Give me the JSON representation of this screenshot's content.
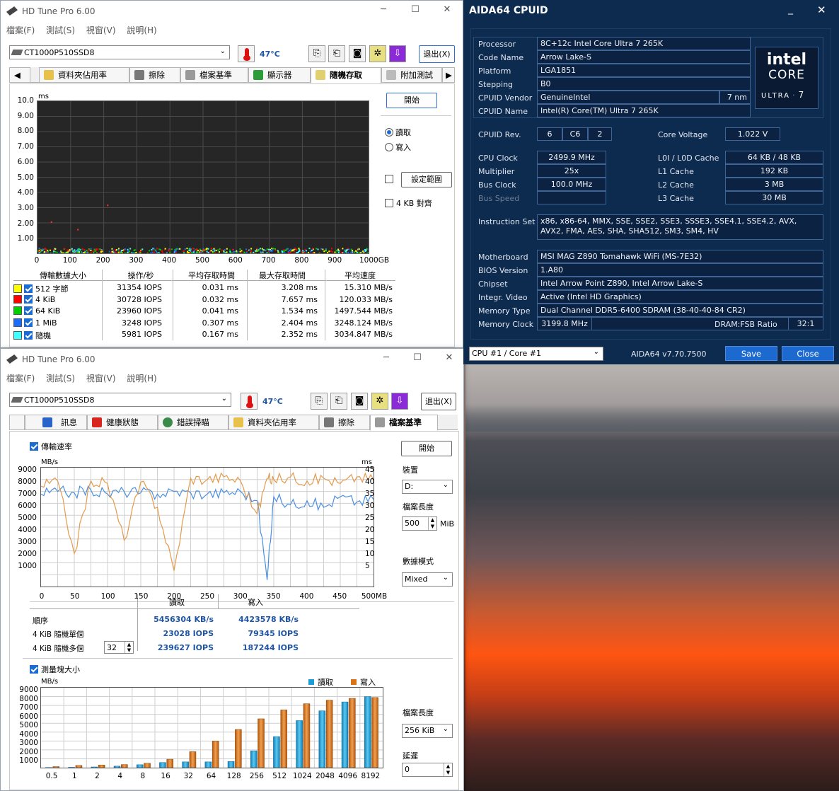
{
  "hdtune_top": {
    "title": "HD Tune Pro 6.00",
    "menu": [
      "檔案(F)",
      "測試(S)",
      "視窗(V)",
      "說明(H)"
    ],
    "drive": "CT1000P510SSD8",
    "temperature": "47°C",
    "exit_label": "退出(X)",
    "tabs": [
      "資料夾佔用率",
      "擦除",
      "檔案基準",
      "顯示器",
      "隨機存取",
      "附加測試"
    ],
    "active_tab": "隨機存取",
    "start_label": "開始",
    "radio_read": "讀取",
    "radio_write": "寫入",
    "set_range_label": "設定範圍",
    "align_4kb": "4 KB 對齊",
    "chart": {
      "y_unit": "ms",
      "y_ticks": [
        "10.0",
        "9.00",
        "8.00",
        "7.00",
        "6.00",
        "5.00",
        "4.00",
        "3.00",
        "2.00",
        "1.00"
      ],
      "x_ticks": [
        "0",
        "100",
        "200",
        "300",
        "400",
        "500",
        "600",
        "700",
        "800",
        "900",
        "1000GB"
      ]
    },
    "table": {
      "headers": [
        "傳輸數據大小",
        "操作/秒",
        "平均存取時間",
        "最大存取時間",
        "平均速度"
      ],
      "rows": [
        {
          "color": "#ffff00",
          "name": "512 字節",
          "iops": "31354 IOPS",
          "avg": "0.031 ms",
          "max": "3.208 ms",
          "speed": "15.310 MB/s"
        },
        {
          "color": "#ff0000",
          "name": "4 KiB",
          "iops": "30728 IOPS",
          "avg": "0.032 ms",
          "max": "7.657 ms",
          "speed": "120.033 MB/s"
        },
        {
          "color": "#00d000",
          "name": "64 KiB",
          "iops": "23960 IOPS",
          "avg": "0.041 ms",
          "max": "1.534 ms",
          "speed": "1497.544 MB/s"
        },
        {
          "color": "#1a6cff",
          "name": "1 MiB",
          "iops": "3248 IOPS",
          "avg": "0.307 ms",
          "max": "2.404 ms",
          "speed": "3248.124 MB/s"
        },
        {
          "color": "#40ffff",
          "name": "隨機",
          "iops": "5981 IOPS",
          "avg": "0.167 ms",
          "max": "2.352 ms",
          "speed": "3034.847 MB/s"
        }
      ]
    }
  },
  "hdtune_bottom": {
    "title": "HD Tune Pro 6.00",
    "menu": [
      "檔案(F)",
      "測試(S)",
      "視窗(V)",
      "說明(H)"
    ],
    "drive": "CT1000P510SSD8",
    "temperature": "47°C",
    "exit_label": "退出(X)",
    "tabs": [
      "訊息",
      "健康狀態",
      "錯誤掃瞄",
      "資料夾佔用率",
      "擦除",
      "檔案基準"
    ],
    "active_tab": "檔案基準",
    "transfer_rate_label": "傳輸速率",
    "start_label": "開始",
    "device_label": "裝置",
    "device_value": "D:",
    "file_length_label": "檔案長度",
    "file_length_value": "500",
    "file_length_unit": "MiB",
    "data_mode_label": "數據模式",
    "data_mode_value": "Mixed",
    "chart1": {
      "y_unit_left": "MB/s",
      "y_unit_right": "ms",
      "y_ticks_left": [
        "9000",
        "8000",
        "7000",
        "6000",
        "5000",
        "4000",
        "3000",
        "2000",
        "1000"
      ],
      "y_ticks_right": [
        "45",
        "40",
        "35",
        "30",
        "25",
        "20",
        "15",
        "10",
        "5"
      ],
      "x_ticks": [
        "0",
        "50",
        "100",
        "150",
        "200",
        "250",
        "300",
        "350",
        "400",
        "450",
        "500MB"
      ]
    },
    "results": {
      "read_header": "讀取",
      "write_header": "寫入",
      "rows": [
        {
          "label": "順序",
          "read": "5456304 KB/s",
          "write": "4423578 KB/s"
        },
        {
          "label": "4 KiB 隨機單個",
          "read": "23028 IOPS",
          "write": "79345 IOPS"
        },
        {
          "label": "4 KiB 隨機多個",
          "read": "239627 IOPS",
          "write": "187244 IOPS"
        }
      ],
      "queue_depth": "32"
    },
    "block_size_label": "測量塊大小",
    "file_length2_label": "檔案長度",
    "file_length2_value": "256 KiB",
    "delay_label": "延遲",
    "delay_value": "0",
    "chart2": {
      "y_unit": "MB/s",
      "legend_read": "讀取",
      "legend_write": "寫入",
      "y_ticks": [
        "9000",
        "8000",
        "7000",
        "6000",
        "5000",
        "4000",
        "3000",
        "2000",
        "1000"
      ]
    }
  },
  "chart_data": [
    {
      "type": "bar",
      "ylabel": "MB/s",
      "categories": [
        "0.5",
        "1",
        "2",
        "4",
        "8",
        "16",
        "32",
        "64",
        "128",
        "256",
        "512",
        "1024",
        "2048",
        "4096",
        "8192"
      ],
      "ylim": [
        0,
        9000
      ],
      "series": [
        {
          "name": "讀取",
          "color": "#1b9ed6",
          "values": [
            20,
            40,
            80,
            170,
            330,
            580,
            650,
            650,
            700,
            1900,
            3500,
            5300,
            6400,
            7400,
            8000
          ]
        },
        {
          "name": "寫入",
          "color": "#d9731a",
          "values": [
            120,
            250,
            300,
            350,
            500,
            950,
            1800,
            3000,
            4300,
            5500,
            6500,
            7200,
            7600,
            7800,
            7900
          ]
        }
      ]
    },
    {
      "type": "line",
      "xlabel": "MB",
      "ylabel": "MB/s",
      "xlim": [
        0,
        500
      ],
      "ylim": [
        0,
        9000
      ],
      "series": [
        {
          "name": "讀取",
          "color": "#4a8fe0",
          "x": [
            0,
            25,
            50,
            75,
            100,
            125,
            150,
            175,
            200,
            225,
            250,
            275,
            300,
            325,
            340,
            350,
            375,
            400,
            425,
            450,
            475,
            500
          ],
          "values": [
            7000,
            7200,
            7100,
            7300,
            7000,
            7200,
            7100,
            7000,
            7200,
            7100,
            7000,
            7100,
            7200,
            6500,
            500,
            6800,
            6200,
            6500,
            6000,
            6800,
            6400,
            6600
          ]
        },
        {
          "name": "寫入",
          "color": "#e39a4c",
          "x": [
            0,
            25,
            50,
            75,
            100,
            125,
            150,
            175,
            200,
            225,
            250,
            275,
            300,
            325,
            340,
            350,
            375,
            400,
            425,
            450,
            475,
            500
          ],
          "values": [
            7600,
            8000,
            2500,
            8000,
            7800,
            3500,
            7900,
            6000,
            1200,
            8200,
            8100,
            8300,
            8000,
            5500,
            8200,
            8100,
            8300,
            8000,
            8200,
            7800,
            8300,
            8100
          ]
        }
      ]
    }
  ],
  "aida": {
    "title": "AIDA64 CPUID",
    "processor_label": "Processor",
    "processor": "8C+12c Intel Core Ultra 7 265K",
    "codename_label": "Code Name",
    "codename": "Arrow Lake-S",
    "platform_label": "Platform",
    "platform": "LGA1851",
    "stepping_label": "Stepping",
    "stepping": "B0",
    "vendor_label": "CPUID Vendor",
    "vendor": "GenuineIntel",
    "process": "7 nm",
    "cpuname_label": "CPUID Name",
    "cpuname": "Intel(R) Core(TM) Ultra 7 265K",
    "rev_label": "CPUID Rev.",
    "rev": [
      "6",
      "C6",
      "2"
    ],
    "voltage_label": "Core Voltage",
    "voltage": "1.022 V",
    "clock_label": "CPU Clock",
    "clock": "2499.9 MHz",
    "mult_label": "Multiplier",
    "mult": "25x",
    "bus_label": "Bus Clock",
    "bus": "100.0 MHz",
    "busspeed_label": "Bus Speed",
    "l0_label": "L0I / L0D Cache",
    "l0": "64 KB / 48 KB",
    "l1_label": "L1 Cache",
    "l1": "192 KB",
    "l2_label": "L2 Cache",
    "l2": "3 MB",
    "l3_label": "L3 Cache",
    "l3": "30 MB",
    "iset_label": "Instruction Set",
    "iset": "x86, x86-64, MMX, SSE, SSE2, SSE3, SSSE3, SSE4.1, SSE4.2, AVX, AVX2, FMA, AES, SHA, SHA512, SM3, SM4, HV",
    "mb_label": "Motherboard",
    "mb": "MSI MAG Z890 Tomahawk WiFi (MS-7E32)",
    "bios_label": "BIOS Version",
    "bios": "1.A80",
    "chipset_label": "Chipset",
    "chipset": "Intel Arrow Point Z890, Intel Arrow Lake-S",
    "video_label": "Integr. Video",
    "video": "Active  (Intel HD Graphics)",
    "memtype_label": "Memory Type",
    "memtype": "Dual Channel DDR5-6400 SDRAM  (38-40-40-84 CR2)",
    "memclock_label": "Memory Clock",
    "memclock": "3199.8 MHz",
    "ratio_label": "DRAM:FSB Ratio",
    "ratio": "32:1",
    "core_select": "CPU #1 / Core #1",
    "version": "AIDA64 v7.70.7500",
    "save_label": "Save",
    "close_label": "Close",
    "logo_word": "intel",
    "logo_core": "CORE",
    "logo_ultra": "ULTRA",
    "logo_num": "7"
  }
}
